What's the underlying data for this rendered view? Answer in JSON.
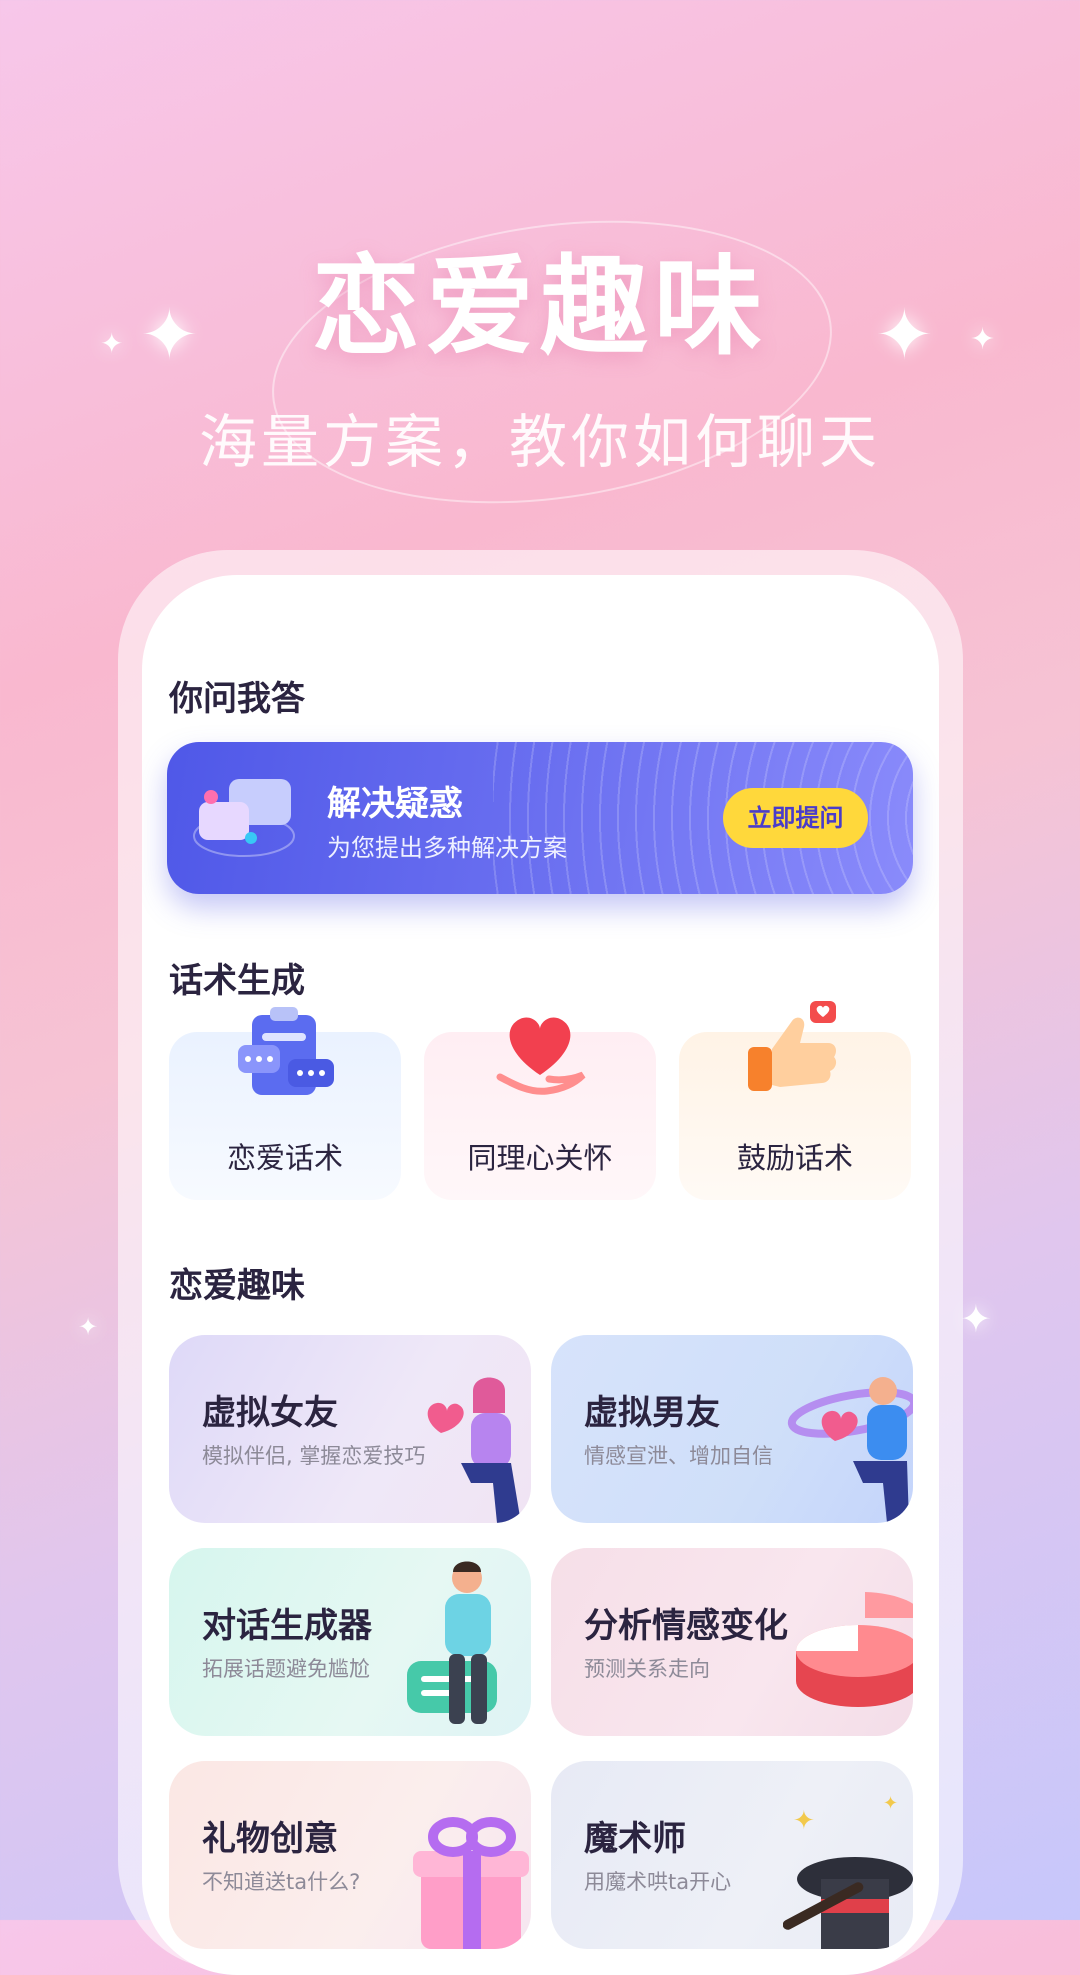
{
  "hero": {
    "title": "恋爱趣味",
    "subtitle": "海量方案，教你如何聊天"
  },
  "qa": {
    "section_title": "你问我答",
    "banner_title": "解决疑惑",
    "banner_subtitle": "为您提出多种解决方案",
    "ask_button": "立即提问"
  },
  "scripts": {
    "section_title": "话术生成",
    "items": [
      {
        "label": "恋爱话术",
        "icon": "clipboard-chat-icon"
      },
      {
        "label": "同理心关怀",
        "icon": "heart-in-hand-icon"
      },
      {
        "label": "鼓励话术",
        "icon": "thumbs-up-icon"
      }
    ]
  },
  "fun": {
    "section_title": "恋爱趣味",
    "items": [
      {
        "title": "虚拟女友",
        "subtitle": "模拟伴侣, 掌握恋爱技巧",
        "icon": "girl-holding-heart-icon"
      },
      {
        "title": "虚拟男友",
        "subtitle": "情感宣泄、增加自信",
        "icon": "boy-holding-heart-icon"
      },
      {
        "title": "对话生成器",
        "subtitle": "拓展话题避免尴尬",
        "icon": "man-with-chat-bubble-icon"
      },
      {
        "title": "分析情感变化",
        "subtitle": "预测关系走向",
        "icon": "pie-chart-icon"
      },
      {
        "title": "礼物创意",
        "subtitle": "不知道送ta什么?",
        "icon": "gift-box-icon"
      },
      {
        "title": "魔术师",
        "subtitle": "用魔术哄ta开心",
        "icon": "magic-hat-icon"
      }
    ]
  }
}
